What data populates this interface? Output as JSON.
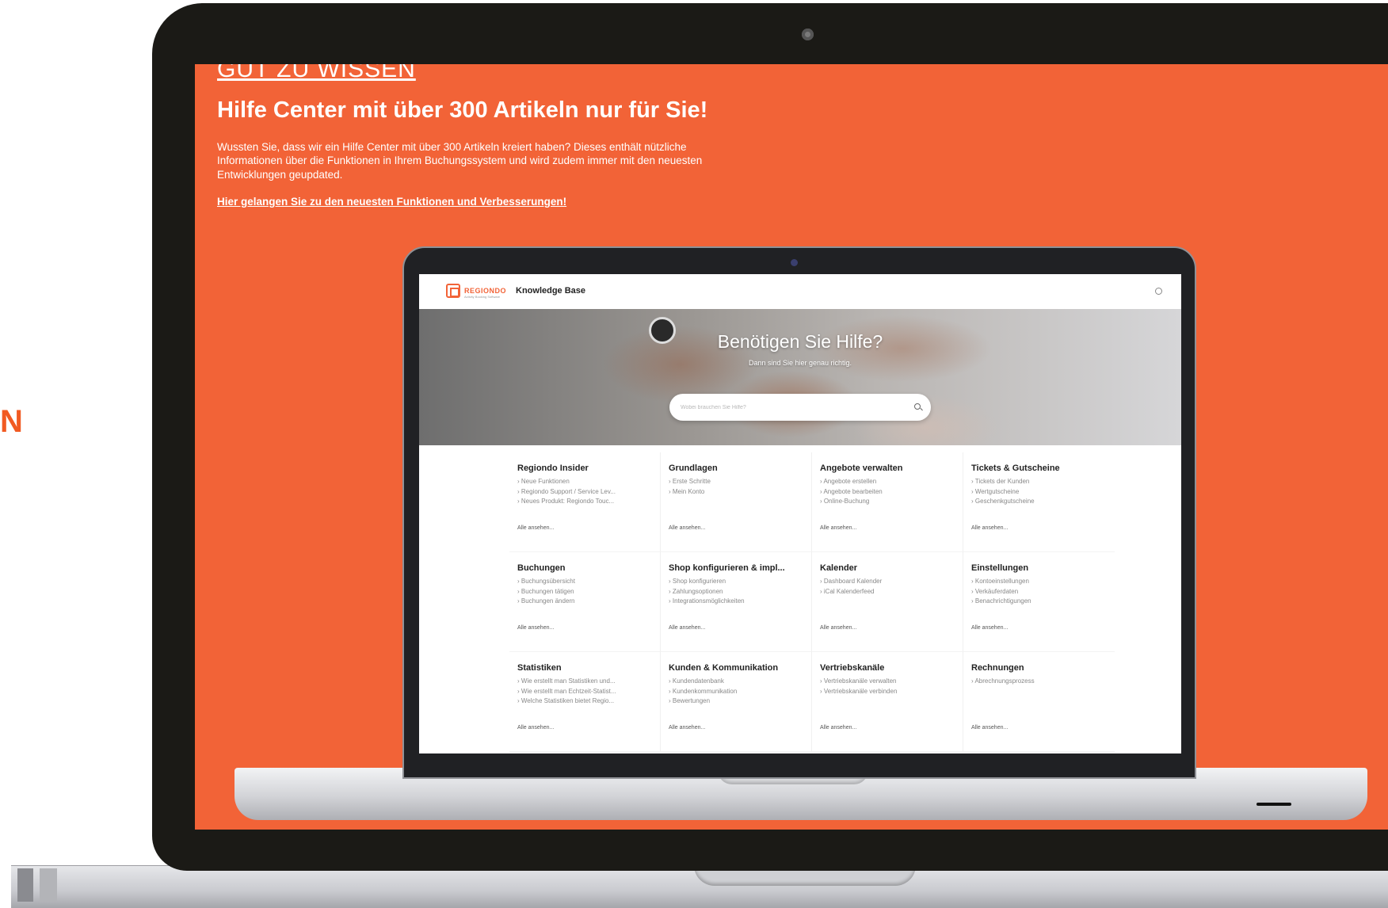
{
  "left_fragment": "N",
  "colors": {
    "accent": "#f26337",
    "bezel": "#1b1a16"
  },
  "promo": {
    "eyebrow": "GUT ZU WISSEN",
    "headline": "Hilfe Center mit über 300 Artikeln nur für Sie!",
    "body": "Wussten Sie, dass wir ein Hilfe Center mit über 300 Artikeln kreiert haben? Dieses enthält nützliche Informationen über die Funktionen in Ihrem Buchungssystem und wird zudem immer mit den neuesten Entwicklungen geupdated.",
    "link": "Hier gelangen Sie zu den neuesten Funktionen und Verbesserungen!"
  },
  "kb": {
    "logo_text": "REGIONDO",
    "logo_sub": "Activity Booking Software",
    "title": "Knowledge Base",
    "globe_icon": "globe-icon",
    "hero_title": "Benötigen Sie Hilfe?",
    "hero_subtitle": "Dann sind Sie hier genau richtig.",
    "search_placeholder": "Wobei brauchen Sie Hilfe?",
    "see_all": "Alle ansehen...",
    "categories": [
      {
        "title": "Regiondo Insider",
        "items": [
          "Neue Funktionen",
          "Regiondo Support / Service Lev...",
          "Neues Produkt: Regiondo Touc..."
        ]
      },
      {
        "title": "Grundlagen",
        "items": [
          "Erste Schritte",
          "Mein Konto"
        ]
      },
      {
        "title": "Angebote verwalten",
        "items": [
          "Angebote erstellen",
          "Angebote bearbeiten",
          "Online-Buchung"
        ]
      },
      {
        "title": "Tickets & Gutscheine",
        "items": [
          "Tickets der Kunden",
          "Wertgutscheine",
          "Geschenkgutscheine"
        ]
      },
      {
        "title": "Buchungen",
        "items": [
          "Buchungsübersicht",
          "Buchungen tätigen",
          "Buchungen ändern"
        ]
      },
      {
        "title": "Shop konfigurieren & impl...",
        "items": [
          "Shop konfigurieren",
          "Zahlungsoptionen",
          "Integrationsmöglichkeiten"
        ]
      },
      {
        "title": "Kalender",
        "items": [
          "Dashboard Kalender",
          "iCal Kalenderfeed"
        ]
      },
      {
        "title": "Einstellungen",
        "items": [
          "Kontoeinstellungen",
          "Verkäuferdaten",
          "Benachrichtigungen"
        ]
      },
      {
        "title": "Statistiken",
        "items": [
          "Wie erstellt man Statistiken und...",
          "Wie erstellt man Echtzeit-Statist...",
          "Welche Statistiken bietet Regio..."
        ]
      },
      {
        "title": "Kunden & Kommunikation",
        "items": [
          "Kundendatenbank",
          "Kundenkommunikation",
          "Bewertungen"
        ]
      },
      {
        "title": "Vertriebskanäle",
        "items": [
          "Vertriebskanäle verwalten",
          "Vertriebskanäle verbinden"
        ]
      },
      {
        "title": "Rechnungen",
        "items": [
          "Abrechnungsprozess"
        ]
      }
    ]
  }
}
